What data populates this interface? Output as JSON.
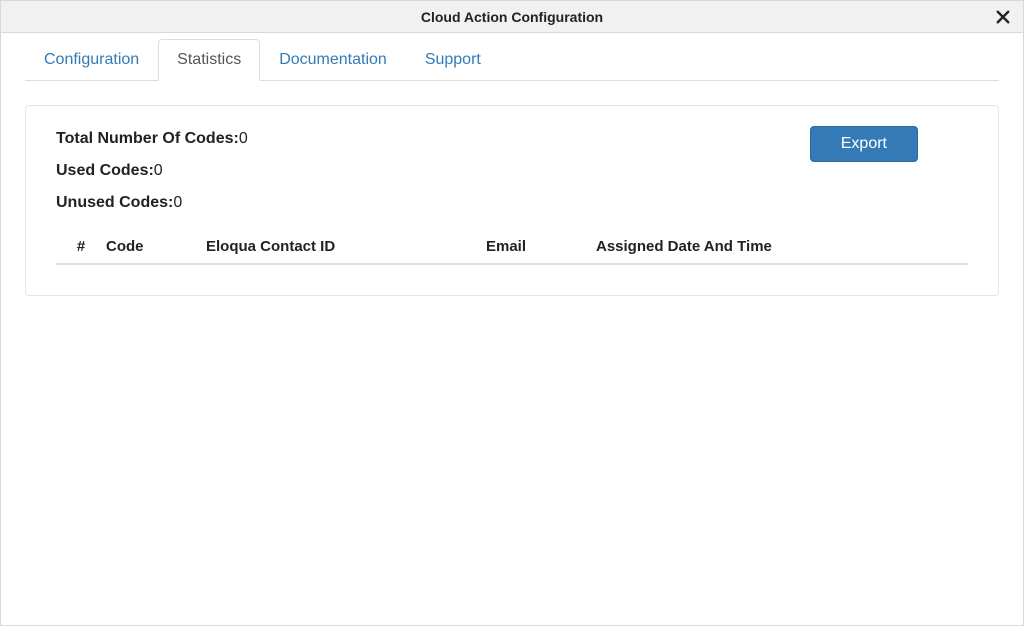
{
  "modal": {
    "title": "Cloud Action Configuration"
  },
  "tabs": {
    "configuration": "Configuration",
    "statistics": "Statistics",
    "documentation": "Documentation",
    "support": "Support"
  },
  "stats": {
    "total_label": "Total Number Of Codes:",
    "total_value": "0",
    "used_label": "Used Codes:",
    "used_value": "0",
    "unused_label": "Unused Codes:",
    "unused_value": "0"
  },
  "buttons": {
    "export": "Export"
  },
  "table": {
    "headers": {
      "num": "#",
      "code": "Code",
      "contact_id": "Eloqua Contact ID",
      "email": "Email",
      "assigned": "Assigned Date And Time"
    },
    "rows": []
  }
}
